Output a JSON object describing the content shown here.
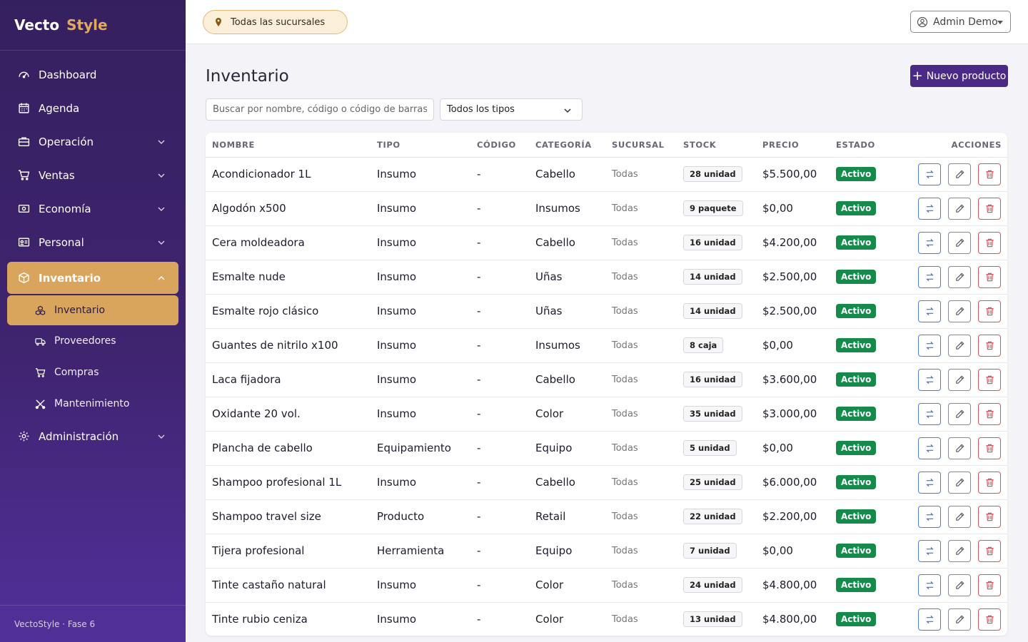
{
  "brand": {
    "part1": "Vecto",
    "part2": "Style"
  },
  "sidebar": {
    "items": [
      {
        "label": "Dashboard",
        "icon": "gauge-icon"
      },
      {
        "label": "Agenda",
        "icon": "calendar-icon"
      },
      {
        "label": "Operación",
        "icon": "briefcase-icon"
      },
      {
        "label": "Ventas",
        "icon": "cart-icon"
      },
      {
        "label": "Economía",
        "icon": "cash-icon"
      },
      {
        "label": "Personal",
        "icon": "id-card-icon"
      },
      {
        "label": "Inventario",
        "icon": "box-icon"
      },
      {
        "label": "Administración",
        "icon": "gear-icon"
      }
    ],
    "subitems": [
      {
        "label": "Inventario",
        "icon": "boxes-icon"
      },
      {
        "label": "Proveedores",
        "icon": "truck-icon"
      },
      {
        "label": "Compras",
        "icon": "cart-icon"
      },
      {
        "label": "Mantenimiento",
        "icon": "tools-icon"
      }
    ],
    "footer": "VectoStyle · Fase 6"
  },
  "topbar": {
    "branch": "Todas las sucursales",
    "user": "Admin Demo"
  },
  "page": {
    "title": "Inventario",
    "new_button": "Nuevo producto",
    "search_placeholder": "Buscar por nombre, código o código de barras",
    "type_filter": "Todos los tipos"
  },
  "table": {
    "columns": [
      "NOMBRE",
      "TIPO",
      "CÓDIGO",
      "CATEGORÍA",
      "SUCURSAL",
      "STOCK",
      "PRECIO",
      "ESTADO",
      "ACCIONES"
    ],
    "rows": [
      {
        "nombre": "Acondicionador 1L",
        "tipo": "Insumo",
        "codigo": "-",
        "categoria": "Cabello",
        "sucursal": "Todas",
        "stock": "28 unidad",
        "precio": "$5.500,00",
        "estado": "Activo"
      },
      {
        "nombre": "Algodón x500",
        "tipo": "Insumo",
        "codigo": "-",
        "categoria": "Insumos",
        "sucursal": "Todas",
        "stock": "9 paquete",
        "precio": "$0,00",
        "estado": "Activo"
      },
      {
        "nombre": "Cera moldeadora",
        "tipo": "Insumo",
        "codigo": "-",
        "categoria": "Cabello",
        "sucursal": "Todas",
        "stock": "16 unidad",
        "precio": "$4.200,00",
        "estado": "Activo"
      },
      {
        "nombre": "Esmalte nude",
        "tipo": "Insumo",
        "codigo": "-",
        "categoria": "Uñas",
        "sucursal": "Todas",
        "stock": "14 unidad",
        "precio": "$2.500,00",
        "estado": "Activo"
      },
      {
        "nombre": "Esmalte rojo clásico",
        "tipo": "Insumo",
        "codigo": "-",
        "categoria": "Uñas",
        "sucursal": "Todas",
        "stock": "14 unidad",
        "precio": "$2.500,00",
        "estado": "Activo"
      },
      {
        "nombre": "Guantes de nitrilo x100",
        "tipo": "Insumo",
        "codigo": "-",
        "categoria": "Insumos",
        "sucursal": "Todas",
        "stock": "8 caja",
        "precio": "$0,00",
        "estado": "Activo"
      },
      {
        "nombre": "Laca fijadora",
        "tipo": "Insumo",
        "codigo": "-",
        "categoria": "Cabello",
        "sucursal": "Todas",
        "stock": "16 unidad",
        "precio": "$3.600,00",
        "estado": "Activo"
      },
      {
        "nombre": "Oxidante 20 vol.",
        "tipo": "Insumo",
        "codigo": "-",
        "categoria": "Color",
        "sucursal": "Todas",
        "stock": "35 unidad",
        "precio": "$3.000,00",
        "estado": "Activo"
      },
      {
        "nombre": "Plancha de cabello",
        "tipo": "Equipamiento",
        "codigo": "-",
        "categoria": "Equipo",
        "sucursal": "Todas",
        "stock": "5 unidad",
        "precio": "$0,00",
        "estado": "Activo"
      },
      {
        "nombre": "Shampoo profesional 1L",
        "tipo": "Insumo",
        "codigo": "-",
        "categoria": "Cabello",
        "sucursal": "Todas",
        "stock": "25 unidad",
        "precio": "$6.000,00",
        "estado": "Activo"
      },
      {
        "nombre": "Shampoo travel size",
        "tipo": "Producto",
        "codigo": "-",
        "categoria": "Retail",
        "sucursal": "Todas",
        "stock": "22 unidad",
        "precio": "$2.200,00",
        "estado": "Activo"
      },
      {
        "nombre": "Tijera profesional",
        "tipo": "Herramienta",
        "codigo": "-",
        "categoria": "Equipo",
        "sucursal": "Todas",
        "stock": "7 unidad",
        "precio": "$0,00",
        "estado": "Activo"
      },
      {
        "nombre": "Tinte castaño natural",
        "tipo": "Insumo",
        "codigo": "-",
        "categoria": "Color",
        "sucursal": "Todas",
        "stock": "24 unidad",
        "precio": "$4.800,00",
        "estado": "Activo"
      },
      {
        "nombre": "Tinte rubio ceniza",
        "tipo": "Insumo",
        "codigo": "-",
        "categoria": "Color",
        "sucursal": "Todas",
        "stock": "13 unidad",
        "precio": "$4.800,00",
        "estado": "Activo"
      }
    ]
  },
  "colors": {
    "sidebar": "#3f2470",
    "accent": "#d9a55c",
    "primary": "#4a2a86",
    "success": "#168a4a",
    "danger": "#d6545a",
    "info": "#4a7fd6"
  }
}
